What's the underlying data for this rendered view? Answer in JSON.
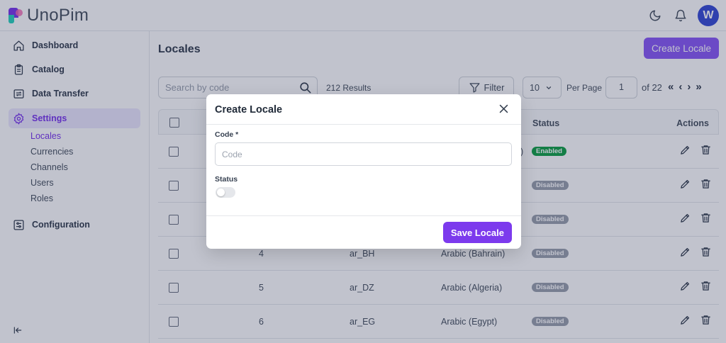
{
  "app": {
    "name": "UnoPim",
    "avatar_initial": "W"
  },
  "sidebar": {
    "items": [
      {
        "label": "Dashboard"
      },
      {
        "label": "Catalog"
      },
      {
        "label": "Data Transfer"
      },
      {
        "label": "Settings"
      },
      {
        "label": "Configuration"
      }
    ],
    "settings_subitems": [
      {
        "label": "Locales"
      },
      {
        "label": "Currencies"
      },
      {
        "label": "Channels"
      },
      {
        "label": "Users"
      },
      {
        "label": "Roles"
      }
    ]
  },
  "main": {
    "title": "Locales",
    "create_button": "Create Locale",
    "search_placeholder": "Search by code",
    "results": "212 Results",
    "filter_label": "Filter",
    "per_page_value": "10",
    "per_page_label": "Per Page",
    "page_value": "1",
    "page_total": "of 22",
    "table": {
      "headers": {
        "status": "Status",
        "actions": "Actions"
      },
      "rows": [
        {
          "id": "",
          "code": "",
          "name": ")",
          "status": "Enabled",
          "enabled": true
        },
        {
          "id": "",
          "code": "",
          "name": "",
          "status": "Disabled",
          "enabled": false
        },
        {
          "id": "",
          "code": "",
          "name": "",
          "status": "Disabled",
          "enabled": false
        },
        {
          "id": "4",
          "code": "ar_BH",
          "name": "Arabic (Bahrain)",
          "status": "Disabled",
          "enabled": false
        },
        {
          "id": "5",
          "code": "ar_DZ",
          "name": "Arabic (Algeria)",
          "status": "Disabled",
          "enabled": false
        },
        {
          "id": "6",
          "code": "ar_EG",
          "name": "Arabic (Egypt)",
          "status": "Disabled",
          "enabled": false
        }
      ]
    }
  },
  "modal": {
    "title": "Create Locale",
    "code_label": "Code *",
    "code_placeholder": "Code",
    "code_value": "",
    "status_label": "Status",
    "status_on": false,
    "save_button": "Save Locale"
  },
  "colors": {
    "accent": "#7c3aed",
    "accent_light": "#8b5cf6",
    "enabled": "#16a34a",
    "disabled": "#9ca3af"
  }
}
